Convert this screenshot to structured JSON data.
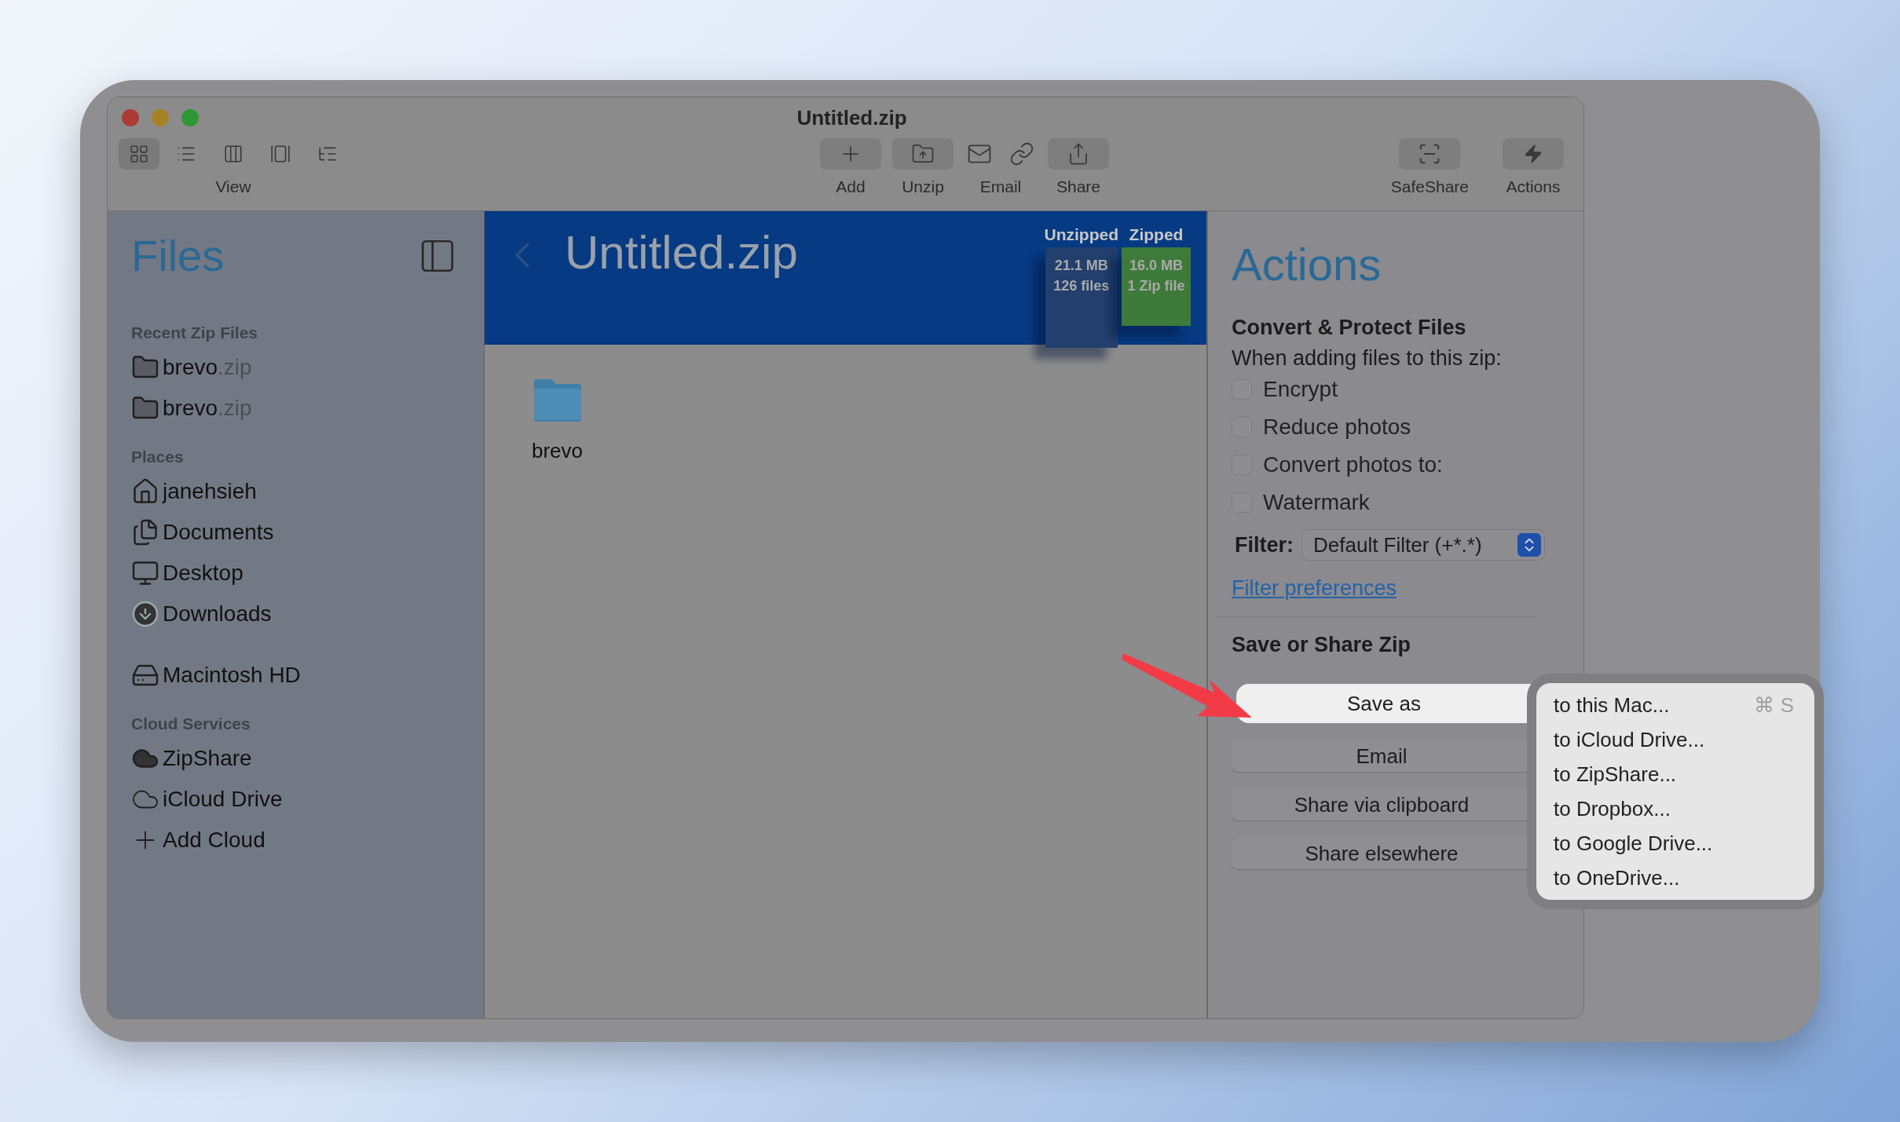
{
  "window": {
    "title": "Untitled.zip"
  },
  "toolbar": {
    "view_modes": [
      {
        "kind": "grid",
        "selected": true
      },
      {
        "kind": "list",
        "selected": false
      },
      {
        "kind": "columns",
        "selected": false
      },
      {
        "kind": "gallery",
        "selected": false
      },
      {
        "kind": "outline",
        "selected": false
      }
    ],
    "view_label": "View",
    "actions": [
      {
        "kind": "add",
        "label": "Add"
      },
      {
        "kind": "unzip",
        "label": "Unzip"
      },
      {
        "kind": "email",
        "label": "Email"
      },
      {
        "kind": "share",
        "label": "Share"
      }
    ],
    "right_actions": [
      {
        "kind": "safeshare",
        "label": "SafeShare"
      },
      {
        "kind": "actions",
        "label": "Actions"
      }
    ]
  },
  "sidebar": {
    "title": "Files",
    "sections": [
      {
        "heading": "Recent Zip Files",
        "items": [
          {
            "kind": "zip",
            "name": "brevo",
            "extension": ".zip"
          },
          {
            "kind": "zip",
            "name": "brevo",
            "extension": ".zip"
          }
        ]
      },
      {
        "heading": "Places",
        "items": [
          {
            "kind": "home",
            "name": "janehsieh"
          },
          {
            "kind": "documents",
            "name": "Documents"
          },
          {
            "kind": "desktop",
            "name": "Desktop"
          },
          {
            "kind": "downloads",
            "name": "Downloads"
          }
        ]
      },
      {
        "items": [
          {
            "kind": "disk",
            "name": "Macintosh HD"
          }
        ]
      },
      {
        "heading": "Cloud Services",
        "items": [
          {
            "kind": "zipshare",
            "name": "ZipShare"
          },
          {
            "kind": "icloud",
            "name": "iCloud Drive"
          },
          {
            "kind": "add",
            "name": "Add Cloud"
          }
        ]
      }
    ]
  },
  "banner": {
    "title": "Untitled.zip",
    "unzipped": {
      "label": "Unzipped",
      "size": "21.1 MB",
      "count": "126 files"
    },
    "zipped": {
      "label": "Zipped",
      "size": "16.0 MB",
      "count": "1 Zip file"
    }
  },
  "files": [
    {
      "name": "brevo"
    }
  ],
  "actions_panel": {
    "title": "Actions",
    "convert_heading": "Convert & Protect Files",
    "convert_note": "When adding files to this zip:",
    "options": [
      {
        "label": "Encrypt",
        "checked": false
      },
      {
        "label": "Reduce photos",
        "checked": false
      },
      {
        "label": "Convert photos to:",
        "checked": false
      },
      {
        "label": "Watermark",
        "checked": false
      }
    ],
    "filter_label": "Filter:",
    "filter_value": "Default Filter (+*.*)",
    "filter_link": "Filter preferences",
    "save_heading": "Save or Share Zip",
    "buttons": [
      {
        "label": "Save as",
        "selected": true
      },
      {
        "label": "Email",
        "selected": false
      },
      {
        "label": "Share via clipboard",
        "selected": false
      },
      {
        "label": "Share elsewhere",
        "selected": false
      }
    ]
  },
  "save_menu": {
    "items": [
      {
        "label": "to this Mac...",
        "shortcut": "⌘ S"
      },
      {
        "label": "to iCloud Drive..."
      },
      {
        "label": "to ZipShare..."
      },
      {
        "label": "to Dropbox..."
      },
      {
        "label": "to Google Drive..."
      },
      {
        "label": "to OneDrive..."
      }
    ]
  }
}
